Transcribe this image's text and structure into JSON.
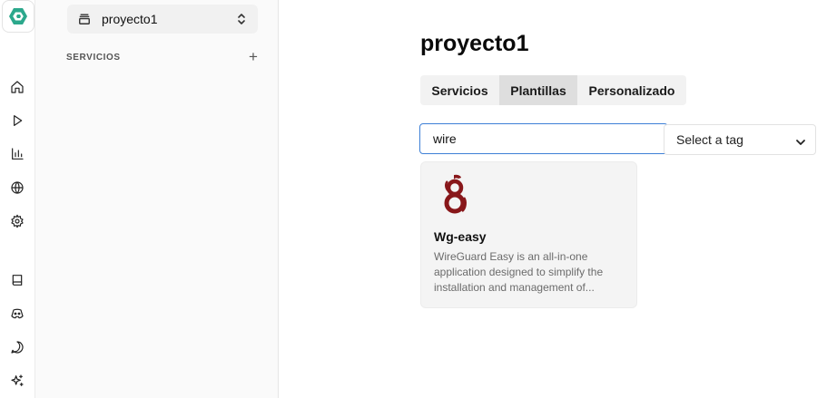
{
  "sidebar": {
    "project": "proyecto1",
    "section_label": "SERVICIOS",
    "add_symbol": "+"
  },
  "main": {
    "title": "proyecto1",
    "tabs": [
      {
        "label": "Servicios",
        "active": false
      },
      {
        "label": "Plantillas",
        "active": true
      },
      {
        "label": "Personalizado",
        "active": false
      }
    ],
    "search": {
      "value": "wire"
    },
    "tag_select": {
      "label": "Select a tag"
    },
    "templates": [
      {
        "name": "Wg-easy",
        "description": "WireGuard Easy is an all-in-one application designed to simplify the installation and management of...",
        "icon": "wireguard-dragon-icon"
      }
    ]
  },
  "rail_icons": [
    "home-icon",
    "play-icon",
    "chart-icon",
    "globe-icon",
    "gear-icon",
    "book-icon",
    "discord-icon",
    "chat-icon",
    "sparkles-icon"
  ],
  "colors": {
    "accent": "#3d7fd6",
    "logo": "#2ba88c",
    "wireguard": "#88171a",
    "active_tab": "#dedede"
  }
}
